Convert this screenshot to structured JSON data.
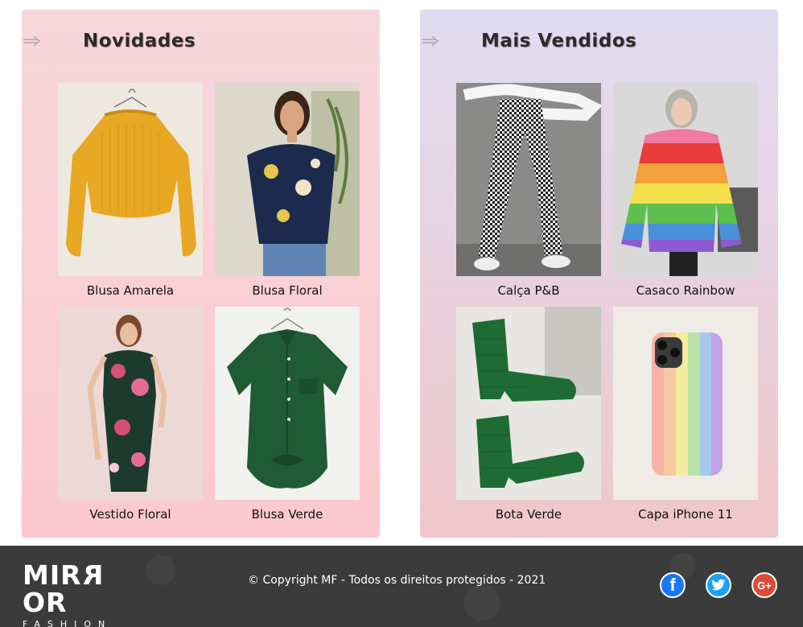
{
  "sections": [
    {
      "title": "Novidades",
      "products": [
        {
          "name": "Blusa Amarela"
        },
        {
          "name": "Blusa Floral"
        },
        {
          "name": "Vestido Floral"
        },
        {
          "name": "Blusa Verde"
        }
      ]
    },
    {
      "title": "Mais Vendidos",
      "products": [
        {
          "name": "Calça P&B"
        },
        {
          "name": "Casaco Rainbow"
        },
        {
          "name": "Bota Verde"
        },
        {
          "name": "Capa iPhone 11"
        }
      ]
    }
  ],
  "footer": {
    "logo_main_pre": "MIR",
    "logo_main_rev": "R",
    "logo_main_post": "OR",
    "logo_sub": "FASHION",
    "copyright": "© Copyright MF - Todos os direitos protegidos - 2021",
    "social": [
      {
        "icon": "facebook-icon",
        "glyph": "f"
      },
      {
        "icon": "twitter-icon",
        "glyph": "🐦"
      },
      {
        "icon": "google-plus-icon",
        "glyph": "G+"
      }
    ]
  },
  "colors": {
    "facebook": "#1877f2",
    "twitter": "#1da1f2",
    "google_plus": "#dd4b39"
  }
}
